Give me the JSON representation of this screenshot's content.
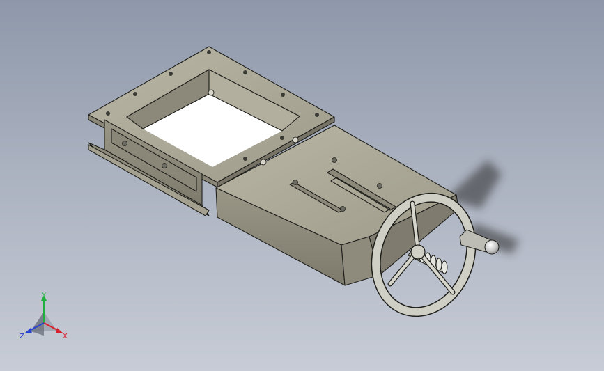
{
  "viewport": {
    "background_top": "#8e98aa",
    "background_bottom": "#c7ccd6"
  },
  "model": {
    "body_color": "#a9a696",
    "edge_color": "#1e1e1a",
    "handle_color": "#cfcfcf"
  },
  "triad": {
    "x_label": "X",
    "y_label": "Y",
    "z_label": "Z",
    "x_color": "#d8202a",
    "y_color": "#20b040",
    "z_color": "#2a40d0"
  }
}
